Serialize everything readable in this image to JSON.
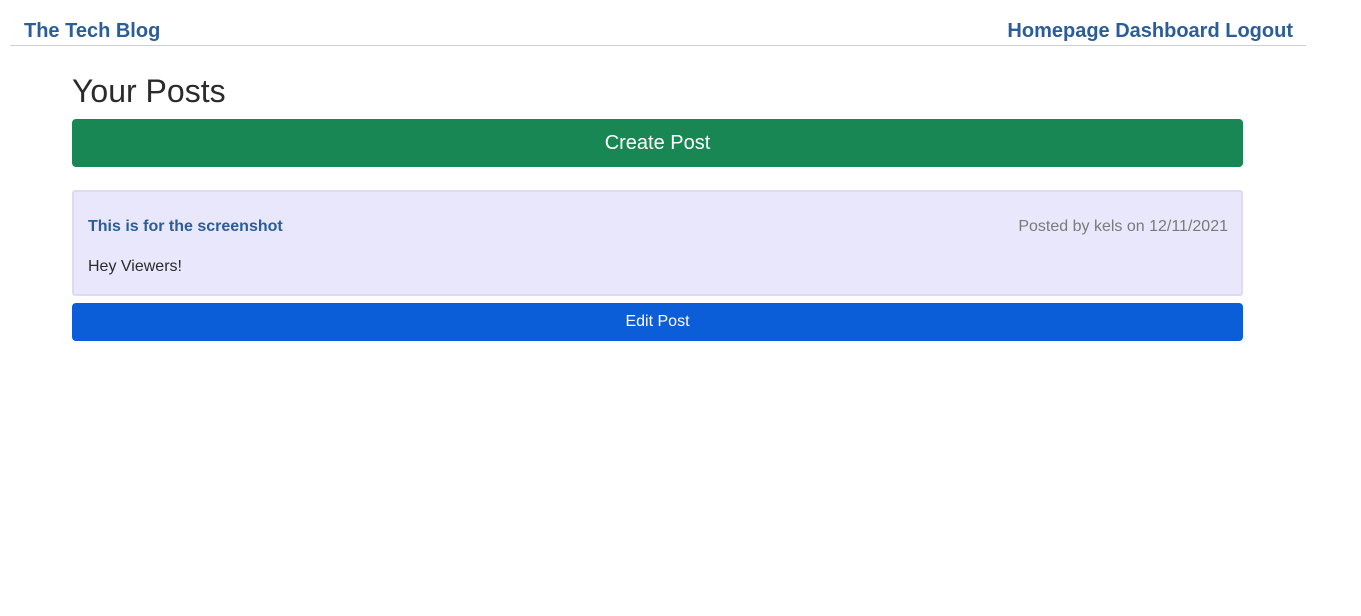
{
  "header": {
    "brand": "The Tech Blog",
    "nav": {
      "homepage": "Homepage",
      "dashboard": "Dashboard",
      "logout": "Logout"
    }
  },
  "main": {
    "title": "Your Posts",
    "create_label": "Create Post",
    "posts": [
      {
        "title": "This is for the screenshot",
        "meta": "Posted by kels on 12/11/2021",
        "body": "Hey Viewers!",
        "edit_label": "Edit Post"
      }
    ]
  },
  "colors": {
    "link": "#2a5d9a",
    "create_button": "#198754",
    "edit_button": "#0b5ed7",
    "card_background": "#e9e7fb"
  }
}
